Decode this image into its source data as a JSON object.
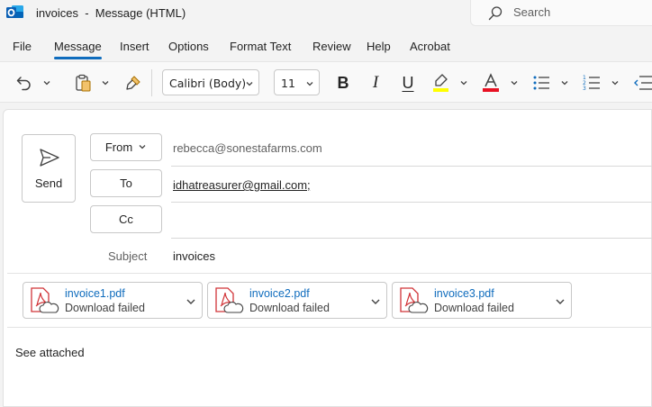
{
  "window": {
    "title": "invoices  -  Message (HTML)",
    "search_placeholder": "Search"
  },
  "menu": {
    "tabs": [
      "File",
      "Message",
      "Insert",
      "Options",
      "Format Text",
      "Review",
      "Help",
      "Acrobat"
    ],
    "active_tab": "Message"
  },
  "ribbon": {
    "font_name": "Calibri (Body)",
    "font_size": "11",
    "bold_label": "B",
    "italic_label": "I",
    "underline_label": "U",
    "font_color_label": "A",
    "highlight_color": "#ffff00",
    "font_color": "#e81123"
  },
  "compose": {
    "send_label": "Send",
    "from_label": "From",
    "to_label": "To",
    "cc_label": "Cc",
    "subject_label": "Subject",
    "from_value": "rebecca@sonestafarms.com",
    "to_value": "idhatreasurer@gmail.com;",
    "cc_value": "",
    "subject_value": "invoices",
    "attachments": [
      {
        "name": "invoice1.pdf",
        "status": "Download failed"
      },
      {
        "name": "invoice2.pdf",
        "status": "Download failed"
      },
      {
        "name": "invoice3.pdf",
        "status": "Download failed"
      }
    ],
    "body": "See attached"
  },
  "colors": {
    "accent": "#0f6cbd",
    "pdf_red": "#d13438"
  }
}
